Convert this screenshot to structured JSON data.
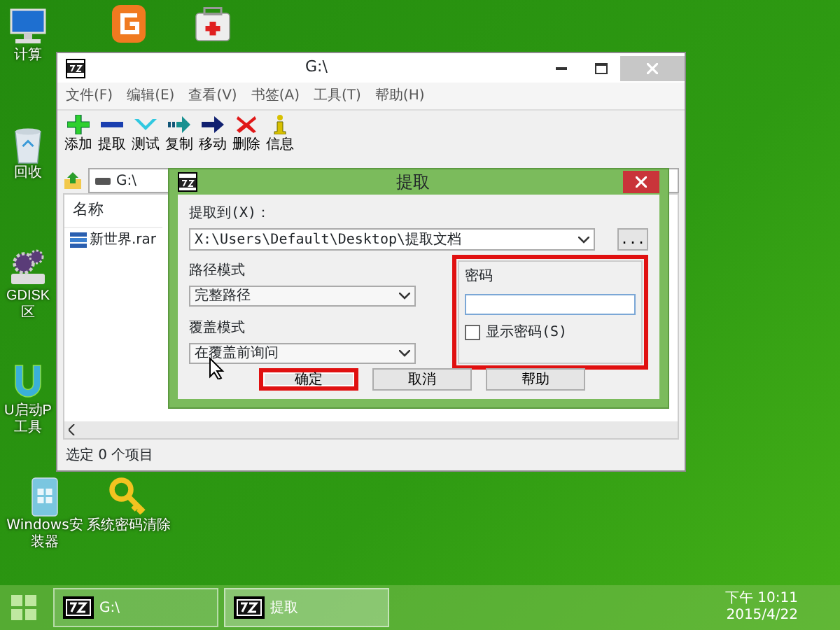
{
  "desktop_icons": [
    {
      "kind": "computer",
      "lines": [
        "计算"
      ]
    },
    {
      "kind": "partition-tool"
    },
    {
      "kind": "toolbox"
    },
    {
      "kind": "recycle-bin",
      "lines": [
        "回收"
      ]
    },
    {
      "kind": "gear-disk",
      "lines": [
        "GDISK",
        "区"
      ]
    },
    {
      "kind": "u-logo",
      "lines": [
        "U启动P",
        "工具"
      ]
    },
    {
      "kind": "installer",
      "lines": [
        "Windows安",
        "装器"
      ]
    },
    {
      "kind": "key",
      "lines": [
        "系统密码清除"
      ]
    }
  ],
  "window": {
    "title": "G:\\",
    "menu": [
      "文件(F)",
      "编辑(E)",
      "查看(V)",
      "书签(A)",
      "工具(T)",
      "帮助(H)"
    ],
    "toolbar": [
      {
        "kind": "add",
        "label": "添加"
      },
      {
        "kind": "extract",
        "label": "提取"
      },
      {
        "kind": "test",
        "label": "测试"
      },
      {
        "kind": "copy",
        "label": "复制"
      },
      {
        "kind": "move",
        "label": "移动"
      },
      {
        "kind": "delete",
        "label": "删除"
      },
      {
        "kind": "info",
        "label": "信息"
      }
    ],
    "address": "G:\\",
    "columns": [
      "名称"
    ],
    "files": [
      {
        "name": "新世界.rar"
      }
    ],
    "status": "选定 0 个项目"
  },
  "dialog": {
    "title": "提取",
    "extract_to_label": "提取到(X)：",
    "path": "X:\\Users\\Default\\Desktop\\提取文档",
    "browse": "...",
    "path_mode_label": "路径模式",
    "path_mode": "完整路径",
    "overwrite_label": "覆盖模式",
    "overwrite": "在覆盖前询问",
    "password": {
      "label": "密码",
      "highlighted": true
    },
    "show_password": {
      "label": "显示密码(S)",
      "checked": false
    },
    "buttons": [
      {
        "label": "确定",
        "highlighted": true
      },
      {
        "label": "取消",
        "highlighted": false
      },
      {
        "label": "帮助",
        "highlighted": false
      }
    ]
  },
  "taskbar": [
    {
      "label": "G:\\",
      "selected": false
    },
    {
      "label": "提取",
      "selected": true
    }
  ],
  "clock": {
    "time": "下午 10:11",
    "date": "2015/4/22"
  }
}
